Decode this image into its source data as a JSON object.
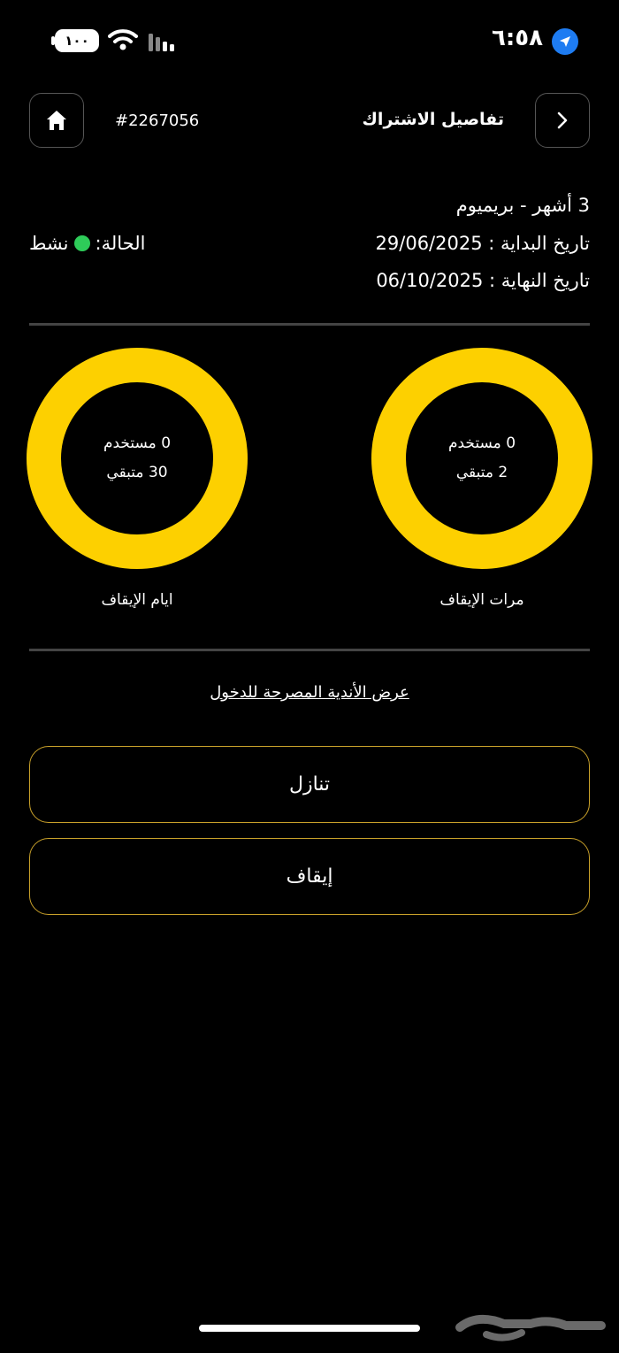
{
  "status_bar": {
    "time": "٦:٥٨",
    "battery": "١٠٠",
    "location_icon": "location-arrow-icon",
    "wifi_icon": "wifi-icon",
    "signal_icon": "cellular-signal-icon"
  },
  "header": {
    "title": "تفاصيل الاشتراك",
    "subscription_id": "#2267056",
    "home_icon": "home-icon",
    "back_icon": "chevron-right-icon"
  },
  "subscription": {
    "plan": "3 أشهر - بريميوم",
    "start_date": "تاريخ البداية : 29/06/2025",
    "end_date": "تاريخ النهاية : 06/10/2025",
    "status_label": "الحالة:",
    "status_value": "نشط",
    "status_color": "#2ecc59"
  },
  "freeze_counts": {
    "used": "0 مستخدم",
    "remaining": "2 متبقي",
    "label": "مرات الإيقاف"
  },
  "freeze_days": {
    "used": "0 مستخدم",
    "remaining": "30 متبقي",
    "label": "ايام الإيقاف"
  },
  "links": {
    "clubs": "عرض الأندية المصرحة للدخول"
  },
  "actions": {
    "transfer": "تنازل",
    "freeze": "إيقاف"
  },
  "colors": {
    "accent": "#fdd000",
    "button_border": "#c9a12a",
    "background": "#000000"
  },
  "watermark": "حراج"
}
